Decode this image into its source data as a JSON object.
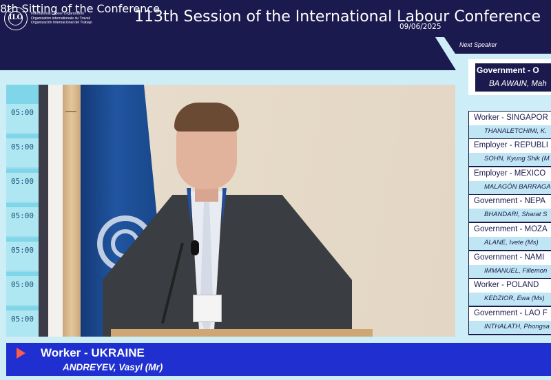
{
  "header": {
    "org_names": [
      "International Labour Organization",
      "Organisation internationale du Travail",
      "Organización Internacional del Trabajo"
    ],
    "logo_letters": "ILO",
    "title": "113th Session of the International Labour Conference"
  },
  "sitting": {
    "title": "8th Sitting of the Conference",
    "date": "09/06/2025"
  },
  "next_speaker": {
    "label": "Next Speaker",
    "group": "Government - O",
    "name": "BA AWAIN, Mah"
  },
  "queue": [
    {
      "group": "Worker - SINGAPOR",
      "name": "THANALETCHIMI, K."
    },
    {
      "group": "Employer - REPUBLI",
      "name": "SOHN, Kyung Shik (M"
    },
    {
      "group": "Employer - MEXICO",
      "name": "MALAGÓN BARRAGA"
    },
    {
      "group": "Government - NEPA",
      "name": "BHANDARI, Sharat S"
    },
    {
      "group": "Government - MOZA",
      "name": "ALANE, Ivete (Ms)"
    },
    {
      "group": "Government - NAMI",
      "name": "IMMANUEL, Fillemon"
    },
    {
      "group": "Worker - POLAND",
      "name": "KEDZIOR, Ewa (Ms)"
    },
    {
      "group": "Government - LAO F",
      "name": "INTHALATH, Phongsa"
    }
  ],
  "video": {
    "clock_times": [
      "05:00",
      "05:00",
      "05:00",
      "05:00",
      "05:00",
      "05:00",
      "05:00"
    ]
  },
  "current_speaker": {
    "group": "Worker - UKRAINE",
    "name": "ANDREYEV, Vasyl (Mr)"
  },
  "colors": {
    "navy": "#1b1a4f",
    "background": "#cdeef7",
    "lower_third": "#1f2fd0",
    "arrow": "#ff5a4a"
  },
  "icons": [
    "ilo-logo-icon",
    "play-arrow-icon"
  ]
}
